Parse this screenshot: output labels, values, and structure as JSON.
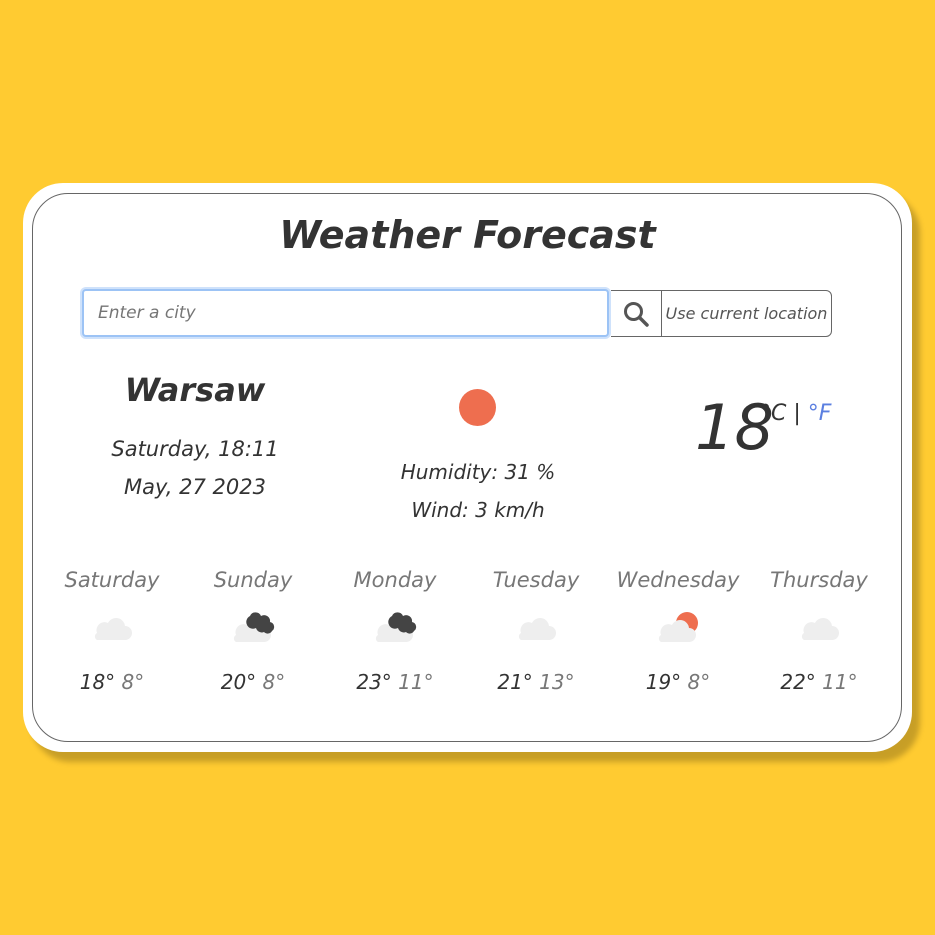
{
  "title": "Weather Forecast",
  "search": {
    "placeholder": "Enter a city",
    "value": "",
    "search_icon": "search-icon",
    "location_label": "Use current location"
  },
  "current": {
    "city": "Warsaw",
    "day_time": "Saturday, 18:11",
    "date": "May, 27 2023",
    "icon": "sun",
    "humidity": "Humidity: 31 %",
    "wind": "Wind: 3 km/h",
    "temperature": "18",
    "unit_c": "°C",
    "separator": "|",
    "unit_f": "°F"
  },
  "colors": {
    "background": "#ffcb31",
    "sun": "#ee6e4f",
    "accent": "#5b7fe0",
    "cloud": "#eeeeee",
    "dark_cloud": "#444444"
  },
  "forecast": [
    {
      "day": "Saturday",
      "icon": "cloud",
      "max": "18°",
      "min": "8°"
    },
    {
      "day": "Sunday",
      "icon": "cloud-dark",
      "max": "20°",
      "min": "8°"
    },
    {
      "day": "Monday",
      "icon": "cloud-dark",
      "max": "23°",
      "min": "11°"
    },
    {
      "day": "Tuesday",
      "icon": "cloud",
      "max": "21°",
      "min": "13°"
    },
    {
      "day": "Wednesday",
      "icon": "cloud-sun",
      "max": "19°",
      "min": "8°"
    },
    {
      "day": "Thursday",
      "icon": "cloud",
      "max": "22°",
      "min": "11°"
    }
  ]
}
